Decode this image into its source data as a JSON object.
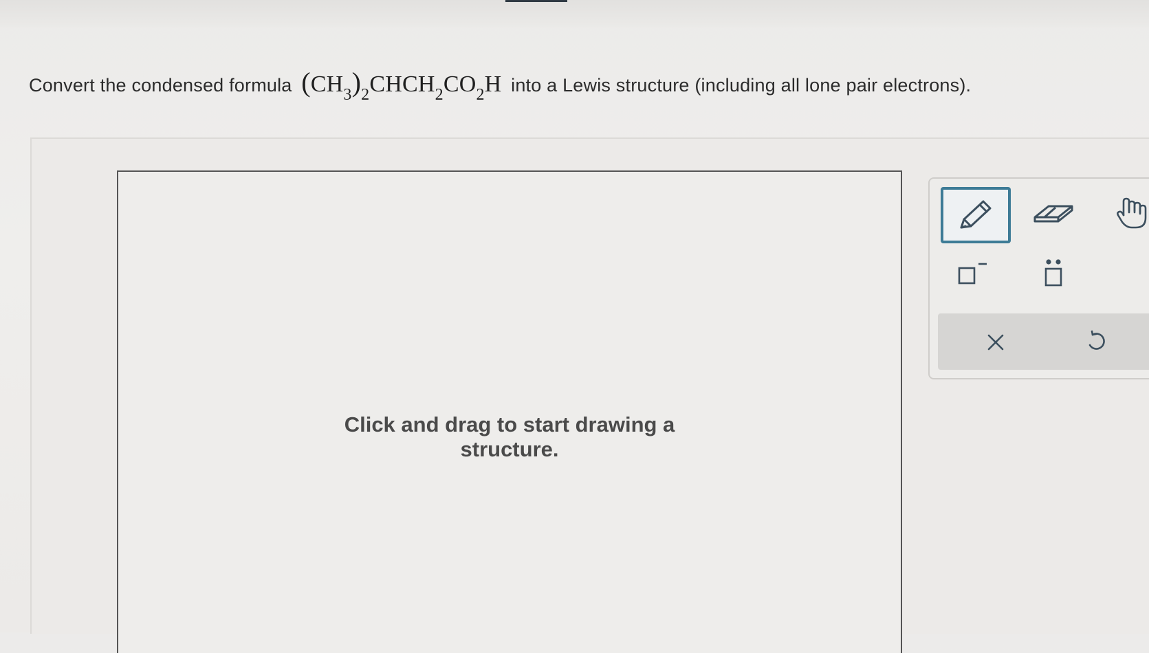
{
  "question": {
    "prefix": "Convert the condensed formula",
    "formula": {
      "open_paren": "(",
      "ch": "CH",
      "ch_sub": "3",
      "close_paren": ")",
      "paren_sub": "2",
      "chch": "CHCH",
      "chch_sub": "2",
      "co": "CO",
      "co_sub": "2",
      "h": "H"
    },
    "suffix": "into a Lewis structure (including all lone pair electrons)."
  },
  "canvas": {
    "hint_line1": "Click and drag to start drawing a",
    "hint_line2": "structure."
  },
  "toolbox": {
    "selected_tool": "pencil",
    "tools": [
      "pencil-icon",
      "eraser-icon",
      "hand-icon",
      "charge-icon",
      "lone-pair-icon",
      "clear-icon",
      "undo-icon"
    ],
    "accent_color": "#3d7b96"
  }
}
